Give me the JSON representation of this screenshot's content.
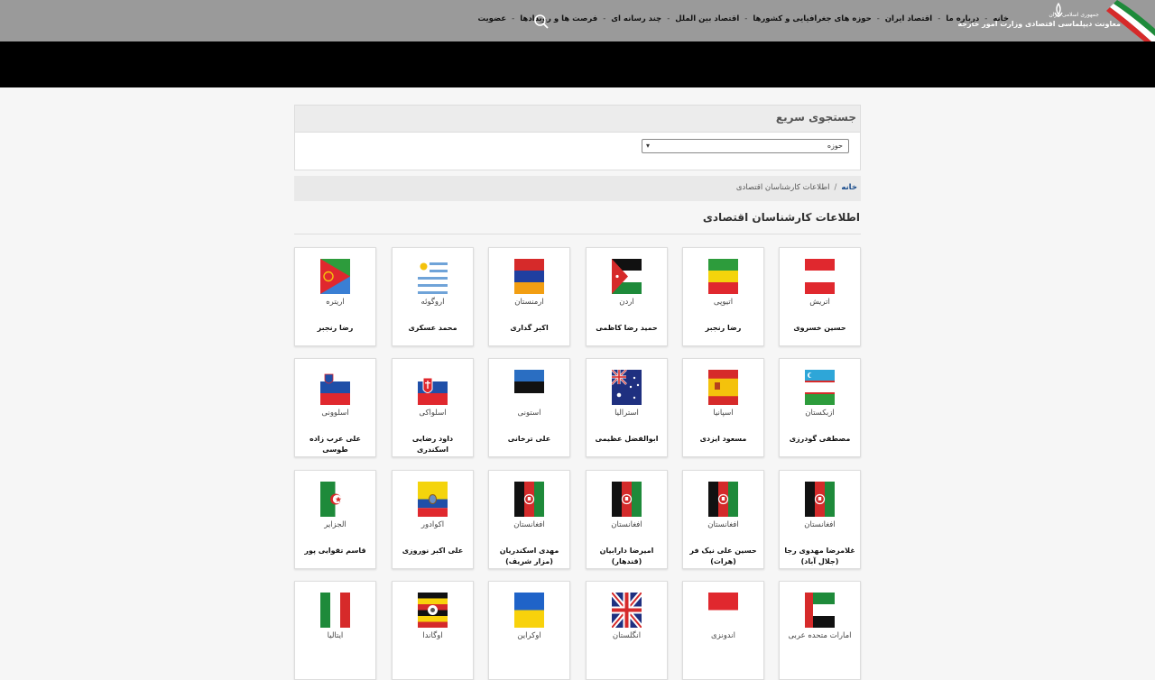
{
  "header": {
    "logo_line1": "جمهوری اسلامی ایران",
    "logo_line2": "معاونت دیپلماسی اقتصادی وزارت امور خارجه",
    "nav": [
      "خانه",
      "درباره ما",
      "اقتصاد ایران",
      "حوزه های جغرافیایی و کشورها",
      "اقتصاد بین الملل",
      "چند رسانه ای",
      "فرصت ها و رویدادها",
      "عضویت"
    ]
  },
  "quick_search": {
    "title": "جستجوی سریع",
    "select_value": "حوزه"
  },
  "breadcrumb": {
    "home": "خانه",
    "separator": "/",
    "current": "اطلاعات کارشناسان اقتصادی"
  },
  "page_title": "اطلاعات کارشناسان اقتصادی",
  "cards": [
    {
      "country": "اتریش",
      "person": "حسین خسروی",
      "flag": "austria"
    },
    {
      "country": "اتیوپی",
      "person": "رضا رنجبر",
      "flag": "ethiopia"
    },
    {
      "country": "اردن",
      "person": "حمید رضا کاظمی",
      "flag": "jordan"
    },
    {
      "country": "ارمنستان",
      "person": "اکبر گداری",
      "flag": "armenia"
    },
    {
      "country": "اروگوئه",
      "person": "محمد عسکری",
      "flag": "uruguay"
    },
    {
      "country": "اریتره",
      "person": "رضا رنجبر",
      "flag": "eritrea"
    },
    {
      "country": "ازبکستان",
      "person": "مصطفی گودرزی",
      "flag": "uzbekistan"
    },
    {
      "country": "اسپانیا",
      "person": "مسعود ایزدی",
      "flag": "spain"
    },
    {
      "country": "استرالیا",
      "person": "ابوالفضل عظیمی",
      "flag": "australia"
    },
    {
      "country": "استونی",
      "person": "علی ترخانی",
      "flag": "estonia"
    },
    {
      "country": "اسلواکی",
      "person": "داود رضایی اسکندری",
      "flag": "slovakia"
    },
    {
      "country": "اسلوونی",
      "person": "علی عرب زاده طوسی",
      "flag": "slovenia"
    },
    {
      "country": "افغانستان",
      "person": "غلامرضا مهدوی رجا (جلال آباد)",
      "flag": "afghanistan"
    },
    {
      "country": "افغانستان",
      "person": "حسین علی نیک فر (هرات)",
      "flag": "afghanistan"
    },
    {
      "country": "افغانستان",
      "person": "امیرضا دارابیان (قندهار)",
      "flag": "afghanistan"
    },
    {
      "country": "افغانستان",
      "person": "مهدی اسکندریان (مزار شریف)",
      "flag": "afghanistan"
    },
    {
      "country": "اکوادور",
      "person": "علی اکبر نوروزی",
      "flag": "ecuador"
    },
    {
      "country": "الجزایر",
      "person": "قاسم تقوایی پور",
      "flag": "algeria"
    },
    {
      "country": "امارات متحده عربی",
      "person": "",
      "flag": "uae"
    },
    {
      "country": "اندونزی",
      "person": "",
      "flag": "indonesia"
    },
    {
      "country": "انگلستان",
      "person": "",
      "flag": "uk"
    },
    {
      "country": "اوکراین",
      "person": "",
      "flag": "ukraine"
    },
    {
      "country": "اوگاندا",
      "person": "",
      "flag": "uganda"
    },
    {
      "country": "ایتالیا",
      "person": "",
      "flag": "italy"
    }
  ]
}
